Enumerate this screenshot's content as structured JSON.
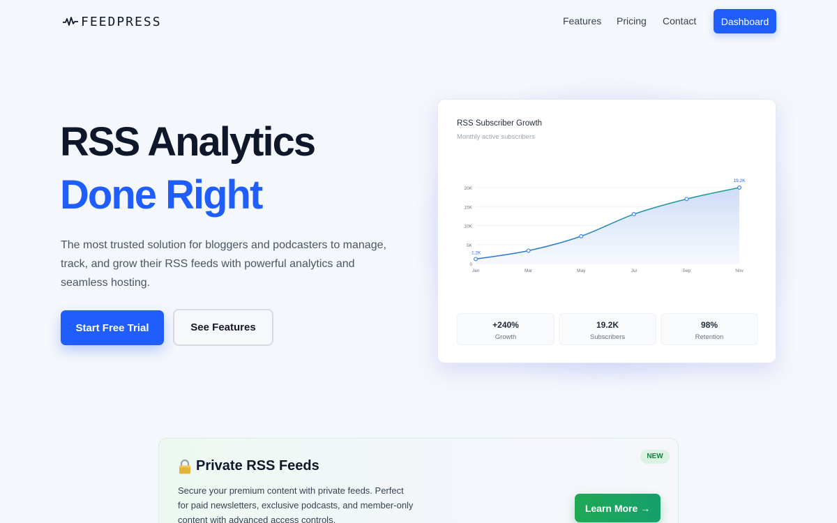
{
  "brand": {
    "name": "FEEDPRESS",
    "logo_icon": "pulse-icon"
  },
  "nav": {
    "links": [
      "Features",
      "Pricing",
      "Contact"
    ],
    "dashboard_label": "Dashboard"
  },
  "hero": {
    "title_line1": "RSS Analytics",
    "title_line2": "Done Right",
    "description": "The most trusted solution for bloggers and podcasters to manage, track, and grow their RSS feeds with powerful analytics and seamless hosting.",
    "primary_cta": "Start Free Trial",
    "secondary_cta": "See Features"
  },
  "chart_card": {
    "title": "RSS Subscriber Growth",
    "subtitle": "Monthly active subscribers",
    "stats": [
      {
        "value": "+240%",
        "label": "Growth"
      },
      {
        "value": "19.2K",
        "label": "Subscribers"
      },
      {
        "value": "98%",
        "label": "Retention"
      }
    ]
  },
  "chart_data": {
    "type": "area",
    "title": "RSS Subscriber Growth",
    "subtitle": "Monthly active subscribers",
    "x": [
      "Jan",
      "Mar",
      "May",
      "Jul",
      "Sep",
      "Nov"
    ],
    "series": [
      {
        "values": [
          1200,
          3400,
          7200,
          13000,
          17000,
          20000
        ]
      }
    ],
    "yticks": [
      "0",
      "5K",
      "10K",
      "15K",
      "20K"
    ],
    "ylim": [
      0,
      20000
    ],
    "point_labels": {
      "first": "1.2K",
      "last": "19.2K"
    },
    "grid": true,
    "colors": {
      "line": "#1f9e8f",
      "fill_top": "#c9d9f7",
      "fill_bottom": "#eef3fc",
      "point": "#3b82f6"
    }
  },
  "feature": {
    "icon": "lock-icon",
    "title": "Private RSS Feeds",
    "badge": "NEW",
    "description": "Secure your premium content with private feeds. Perfect for paid newsletters, exclusive podcasts, and member-only content with advanced access controls.",
    "cta": "Learn More →"
  },
  "colors": {
    "brand": "#1f5efc",
    "success": "#16a34a"
  }
}
